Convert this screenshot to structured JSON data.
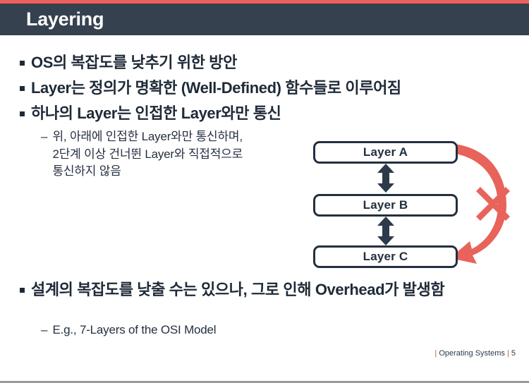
{
  "slide": {
    "title": "Layering",
    "accent_color": "#ef5f5a",
    "header_bg": "#36414f",
    "text_color": "#1f2a38"
  },
  "bullets": [
    {
      "marker": "square",
      "text": "OS의 복잡도를 낮추기 위한 방안"
    },
    {
      "marker": "square",
      "text": "Layer는 정의가 명확한 (Well-Defined) 함수들로 이루어짐"
    },
    {
      "marker": "square",
      "text": "하나의 Layer는 인접한 Layer와만 통신"
    },
    {
      "marker": "square",
      "text": "설계의 복잡도를 낮출 수는 있으나, 그로 인해 Overhead가 발생함"
    }
  ],
  "sub_bullets": [
    {
      "marker": "–",
      "text": "위, 아래에 인접한 Layer와만 통신하며,\n2단계 이상 건너뛴 Layer와 직접적으로\n통신하지 않음"
    },
    {
      "marker": "–",
      "text": "E.g., 7-Layers of the OSI Model"
    }
  ],
  "diagram": {
    "boxes": [
      {
        "label": "Layer A"
      },
      {
        "label": "Layer B"
      },
      {
        "label": "Layer C"
      }
    ],
    "connector_color": "#2d3a4a",
    "forbidden_color": "#e8635a",
    "forbidden_marker": "x-cross"
  },
  "footer": {
    "separator_left": "|",
    "course": "Operating Systems",
    "separator_right": "|",
    "page_number": "5"
  }
}
